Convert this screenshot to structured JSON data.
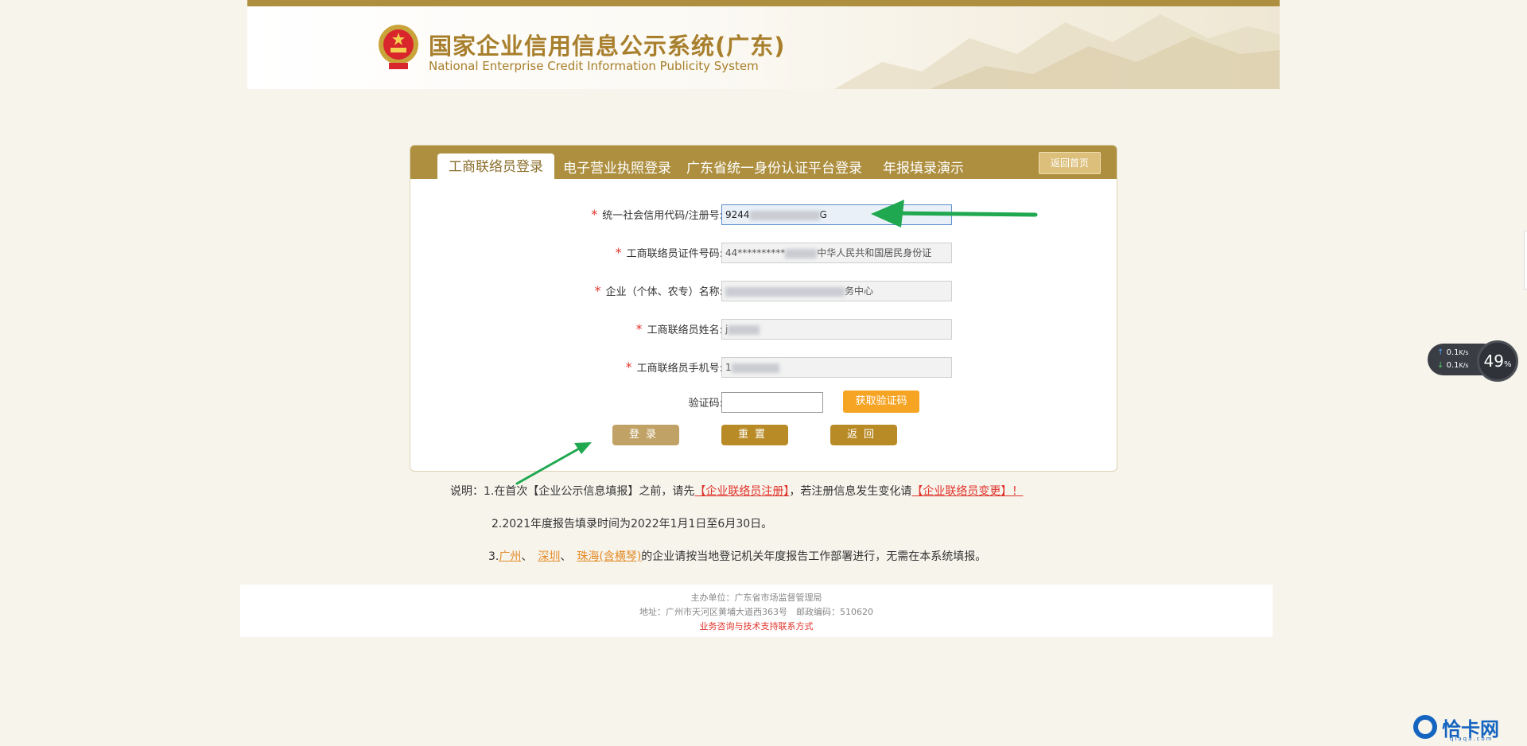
{
  "header": {
    "title_cn": "国家企业信用信息公示系统(广东)",
    "title_en": "National Enterprise Credit Information Publicity System"
  },
  "tabs": [
    {
      "label": "工商联络员登录",
      "active": true
    },
    {
      "label": "电子营业执照登录",
      "active": false
    },
    {
      "label": "广东省统一身份认证平台登录",
      "active": false
    },
    {
      "label": "年报填录演示",
      "active": false
    }
  ],
  "home_button": "返回首页",
  "form": {
    "credit_code": {
      "label": "统一社会信用代码/注册号:",
      "value_prefix": "9244",
      "value_suffix": "G"
    },
    "id_number": {
      "label": "工商联络员证件号码:",
      "value_prefix": "44**********",
      "value_suffix": "中华人民共和国居民身份证"
    },
    "enterprise_name": {
      "label": "企业（个体、农专）名称:",
      "value_suffix": "务中心"
    },
    "contact_name": {
      "label": "工商联络员姓名:",
      "value_prefix": "j"
    },
    "contact_phone": {
      "label": "工商联络员手机号:",
      "value_prefix": "1"
    },
    "captcha": {
      "label": "验证码:",
      "value": ""
    },
    "sms_button": "获取验证码",
    "required_mark": "*"
  },
  "buttons": {
    "login": "登录",
    "reset": "重置",
    "back": "返回"
  },
  "notes": {
    "line1_a": "说明：1.在首次【企业公示信息填报】之前，请先",
    "line1_link1": "【企业联络员注册】",
    "line1_b": "，若注册信息发生变化请",
    "line1_link2": "【企业联络员变更】！",
    "line2": "2.2021年度报告填录时间为2022年1月1日至6月30日。",
    "line3_a": "3.",
    "city1": "广州",
    "sep": "、",
    "city2": "深圳",
    "city3": "珠海(含横琴)",
    "line3_b": "的企业请按当地登记机关年度报告工作部署进行，无需在本系统填报。"
  },
  "footer": {
    "host": "主办单位：广东省市场监督管理局",
    "address": "地址：广州市天河区黄埔大道西363号　邮政编码：510620",
    "contact": "业务咨询与技术支持联系方式"
  },
  "network_widget": {
    "upload": "0.1",
    "download": "0.1",
    "unit": "K/s",
    "percent": "49",
    "percent_sign": "%"
  },
  "watermark": {
    "brand": "恰卡网",
    "domain": "qiaqa.com"
  },
  "colors": {
    "accent": "#ad8f3f",
    "required": "#e0342b",
    "sms": "#f6a424",
    "arrow": "#1fa84f"
  }
}
